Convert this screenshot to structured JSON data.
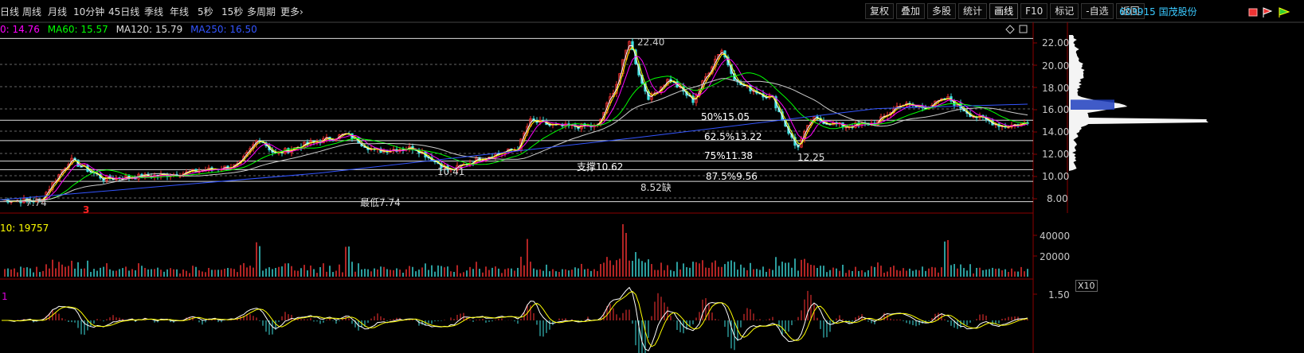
{
  "toolbar": {
    "periods": [
      "日线",
      "周线",
      "月线",
      "10分钟",
      "45日线",
      "季线",
      "年线",
      "5秒",
      "15秒",
      "多周期",
      "更多"
    ],
    "more_chevron": "›",
    "right_buttons": [
      "复权",
      "叠加",
      "多股",
      "统计",
      "画线",
      "F10",
      "标记",
      "-自选",
      "返回"
    ],
    "active_right": "画线"
  },
  "stock": {
    "code": "603915",
    "name": "国茂股份"
  },
  "ma_legend": [
    {
      "label": "0: 14.76",
      "color": "#ff00ff"
    },
    {
      "label": "MA60: 15.57",
      "color": "#00ff00"
    },
    {
      "label": "MA120: 15.79",
      "color": "#dddddd"
    },
    {
      "label": "MA250: 16.50",
      "color": "#3355ff"
    }
  ],
  "price_axis": [
    "22.00",
    "20.00",
    "18.00",
    "16.00",
    "14.00",
    "12.00",
    "10.00",
    "8.00"
  ],
  "volume_axis": [
    "40000",
    "20000"
  ],
  "volume_label": "10: 19757",
  "volume_scale_badge": "X10",
  "indicator_label": "1",
  "indicator_axis": [
    "1.50"
  ],
  "annotations": {
    "high": "22.40",
    "low_left": "7.74",
    "fib_50": "50%15.05",
    "fib_625": "62.5%13.22",
    "fib_75": "75%11.38",
    "fib_875": "87.5%9.56",
    "support": "支撑10.62",
    "point_1041": "10.41",
    "point_1225": "12.25",
    "point_852": "8.52缺",
    "lowest": "最低7.74",
    "marker": "3"
  },
  "colors": {
    "up": "#ff3333",
    "down": "#40e0e0",
    "ma5": "#ffffff",
    "ma10": "#ffff00",
    "ma20": "#ff00ff",
    "ma60": "#00ff00",
    "ma120": "#cccccc",
    "ma250": "#3355ff"
  },
  "icons": [
    "diamond-icon",
    "square-icon",
    "flag-icon"
  ]
}
